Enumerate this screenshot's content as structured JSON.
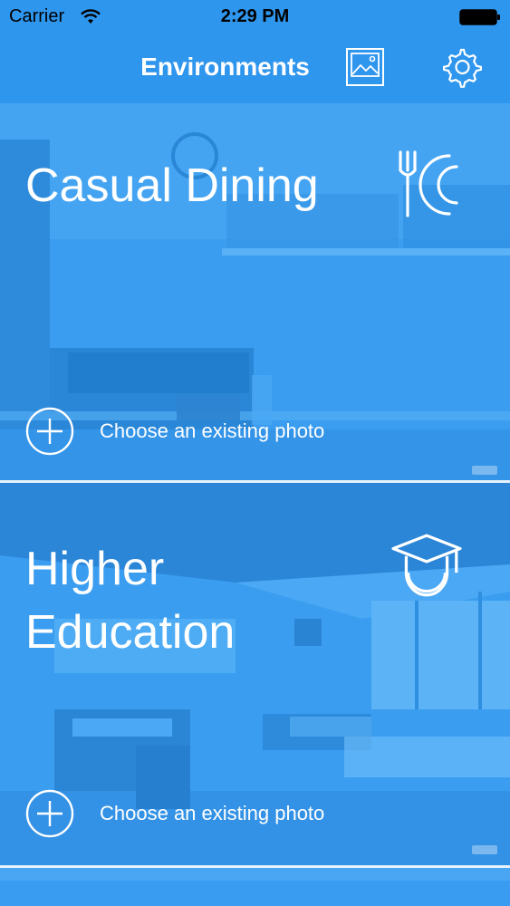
{
  "status_bar": {
    "carrier": "Carrier",
    "time": "2:29 PM",
    "icons": [
      "wifi-icon",
      "battery-icon"
    ]
  },
  "nav": {
    "title": "Environments",
    "icons": [
      "photo-library-icon",
      "gear-icon"
    ]
  },
  "environments": [
    {
      "title": "Casual Dining",
      "icon": "fork-plate-icon",
      "action_label": "Choose an existing photo"
    },
    {
      "title": "Higher\nEducation",
      "icon": "graduation-cap-icon",
      "action_label": "Choose an existing photo"
    }
  ],
  "colors": {
    "accent": "#2f96ee",
    "card_overlay": "#3a9cf0",
    "text": "#ffffff",
    "divider": "#e6f2fd"
  }
}
